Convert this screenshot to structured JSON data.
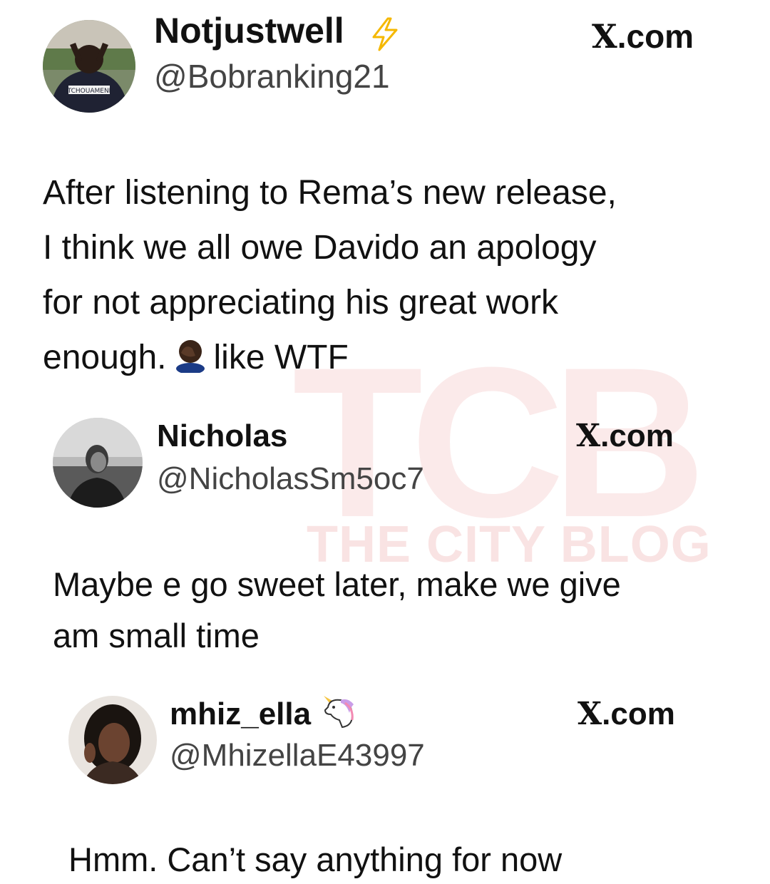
{
  "watermark": {
    "letters": "TCB",
    "text": "THE CITY BLOG"
  },
  "posts": [
    {
      "name": "Notjustwell",
      "handle": "@Bobranking21",
      "source_x": "X",
      "source_rest": ".com",
      "badge_icon": "lightning-icon",
      "avatar_jersey_text": "TCHOUAMENI",
      "text_lines": [
        "After listening to Rema’s new release,",
        "I think we all owe Davido an apology",
        "for not appreciating his great work"
      ],
      "last_line_before_emoji": "enough.",
      "emoji_icon": "facepalm-icon",
      "last_line_after_emoji": "like WTF"
    },
    {
      "name": "Nicholas",
      "handle": "@NicholasSm5oc7",
      "source_x": "X",
      "source_rest": ".com",
      "text_lines": [
        "Maybe e go sweet later, make we give",
        "am small time"
      ]
    },
    {
      "name": "mhiz_ella",
      "handle": "@MhizellaE43997",
      "source_x": "X",
      "source_rest": ".com",
      "badge_icon": "unicorn-icon",
      "text_lines": [
        "Hmm. Can’t say anything for now"
      ]
    }
  ],
  "colors": {
    "lightning": "#f5b800",
    "watermark": "#fbeaea"
  }
}
